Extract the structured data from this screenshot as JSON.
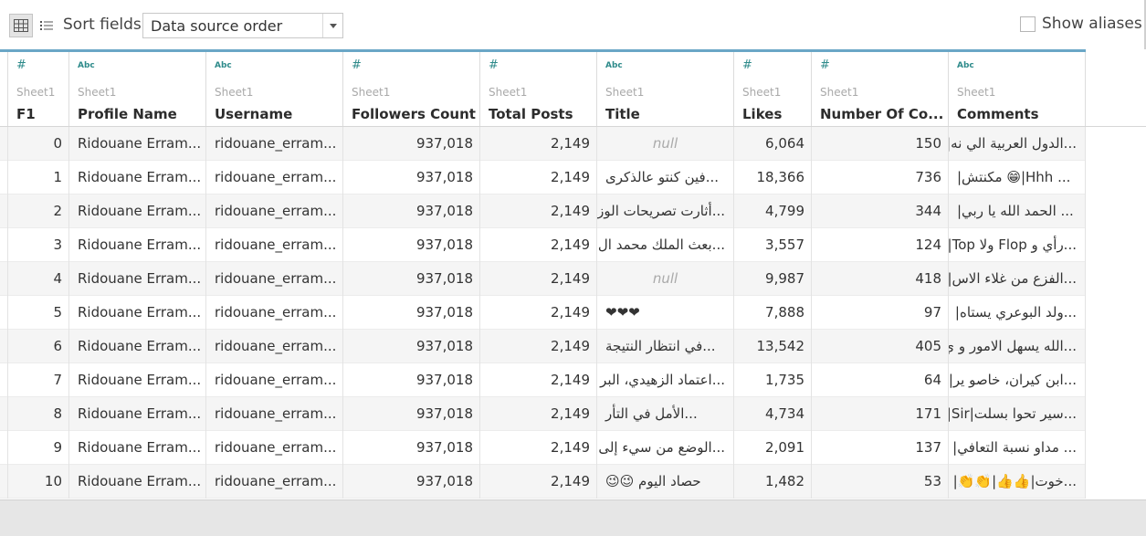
{
  "toolbar": {
    "sort_label": "Sort fields",
    "sort_value": "Data source order",
    "show_aliases_label": "Show aliases",
    "show_aliases_checked": false
  },
  "columns": [
    {
      "type": "#",
      "source": "Sheet1",
      "name": "F1"
    },
    {
      "type": "Abc",
      "source": "Sheet1",
      "name": "Profile Name"
    },
    {
      "type": "Abc",
      "source": "Sheet1",
      "name": "Username"
    },
    {
      "type": "#",
      "source": "Sheet1",
      "name": "Followers Count"
    },
    {
      "type": "#",
      "source": "Sheet1",
      "name": "Total Posts"
    },
    {
      "type": "Abc",
      "source": "Sheet1",
      "name": "Title"
    },
    {
      "type": "#",
      "source": "Sheet1",
      "name": "Likes"
    },
    {
      "type": "#",
      "source": "Sheet1",
      "name": "Number Of Co..."
    },
    {
      "type": "Abc",
      "source": "Sheet1",
      "name": "Comments"
    }
  ],
  "rows": [
    {
      "f1": "0",
      "profile": "Ridouane Erram...",
      "username": "ridouane_erram...",
      "followers": "937,018",
      "posts": "2,149",
      "title": "null",
      "likes": "6,064",
      "num_comments": "150",
      "comments": "...الدول العربية الي نه|"
    },
    {
      "f1": "1",
      "profile": "Ridouane Erram...",
      "username": "ridouane_erram...",
      "followers": "937,018",
      "posts": "2,149",
      "title": "...فين كنتو عالذكرى",
      "likes": "18,366",
      "num_comments": "736",
      "comments": "... Hhh|😁 مكنتش|"
    },
    {
      "f1": "2",
      "profile": "Ridouane Erram...",
      "username": "ridouane_erram...",
      "followers": "937,018",
      "posts": "2,149",
      "title": "...أثارت تصريحات الوزير",
      "likes": "4,799",
      "num_comments": "344",
      "comments": "... الحمد الله يا ربي|"
    },
    {
      "f1": "3",
      "profile": "Ridouane Erram...",
      "username": "ridouane_erram...",
      "followers": "937,018",
      "posts": "2,149",
      "title": "...بعث الملك محمد ال",
      "likes": "3,557",
      "num_comments": "124",
      "comments": "...رأي و Flop ولا Top|"
    },
    {
      "f1": "4",
      "profile": "Ridouane Erram...",
      "username": "ridouane_erram...",
      "followers": "937,018",
      "posts": "2,149",
      "title": "null",
      "likes": "9,987",
      "num_comments": "418",
      "comments": "...الفزع من غلاء الاس|"
    },
    {
      "f1": "5",
      "profile": "Ridouane Erram...",
      "username": "ridouane_erram...",
      "followers": "937,018",
      "posts": "2,149",
      "title": "❤❤❤",
      "likes": "7,888",
      "num_comments": "97",
      "comments": "...ولد البوعري يستاه|"
    },
    {
      "f1": "6",
      "profile": "Ridouane Erram...",
      "username": "ridouane_erram...",
      "followers": "937,018",
      "posts": "2,149",
      "title": "...في انتظار النتيجة",
      "likes": "13,542",
      "num_comments": "405",
      "comments": "...الله يسهل الامور و ي|"
    },
    {
      "f1": "7",
      "profile": "Ridouane Erram...",
      "username": "ridouane_erram...",
      "followers": "937,018",
      "posts": "2,149",
      "title": "...اعتماد الزهيدي، البر",
      "likes": "1,735",
      "num_comments": "64",
      "comments": "...ابن كيران، خاصو ير|"
    },
    {
      "f1": "8",
      "profile": "Ridouane Erram...",
      "username": "ridouane_erram...",
      "followers": "937,018",
      "posts": "2,149",
      "title": "...الأمل في التأر",
      "likes": "4,734",
      "num_comments": "171",
      "comments": "...سير تحوا بسلت|Sir|"
    },
    {
      "f1": "9",
      "profile": "Ridouane Erram...",
      "username": "ridouane_erram...",
      "followers": "937,018",
      "posts": "2,149",
      "title": "...الوضع من سيء إلى",
      "likes": "2,091",
      "num_comments": "137",
      "comments": "... مداو نسبة التعافي|"
    },
    {
      "f1": "10",
      "profile": "Ridouane Erram...",
      "username": "ridouane_erram...",
      "followers": "937,018",
      "posts": "2,149",
      "title": "حصاد اليوم 😉😉",
      "likes": "1,482",
      "num_comments": "53",
      "comments": "...خوت|👍👍|👏👏|"
    }
  ]
}
